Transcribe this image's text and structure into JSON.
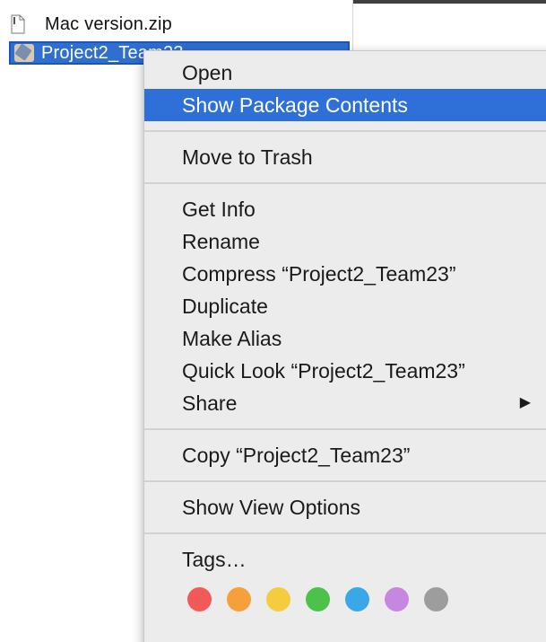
{
  "finder": {
    "files": [
      {
        "name": "Mac version.zip",
        "icon": "document-icon",
        "selected": false
      },
      {
        "name": "Project2_Team23",
        "icon": "app-package-icon",
        "selected": true
      }
    ]
  },
  "context_menu": {
    "groups": [
      {
        "items": [
          {
            "label": "Open"
          },
          {
            "label": "Show Package Contents",
            "highlighted": true
          }
        ]
      },
      {
        "items": [
          {
            "label": "Move to Trash"
          }
        ]
      },
      {
        "items": [
          {
            "label": "Get Info"
          },
          {
            "label": "Rename"
          },
          {
            "label": "Compress “Project2_Team23”"
          },
          {
            "label": "Duplicate"
          },
          {
            "label": "Make Alias"
          },
          {
            "label": "Quick Look “Project2_Team23”"
          },
          {
            "label": "Share",
            "submenu_arrow": "▶"
          }
        ]
      },
      {
        "items": [
          {
            "label": "Copy “Project2_Team23”"
          }
        ]
      },
      {
        "items": [
          {
            "label": "Show View Options"
          }
        ]
      },
      {
        "items": [
          {
            "label": "Tags…"
          }
        ]
      }
    ],
    "tag_colors": [
      {
        "name": "red",
        "color": "#f25a5a"
      },
      {
        "name": "orange",
        "color": "#f5a03a"
      },
      {
        "name": "yellow",
        "color": "#f5cc3e"
      },
      {
        "name": "green",
        "color": "#4cc24a"
      },
      {
        "name": "blue",
        "color": "#3aa7e8"
      },
      {
        "name": "purple",
        "color": "#c687e0"
      },
      {
        "name": "gray",
        "color": "#9d9d9d"
      }
    ]
  },
  "colors": {
    "selection": "#2f6fcf",
    "menu_highlight": "#2f6fd8",
    "menu_background": "#ececec"
  }
}
